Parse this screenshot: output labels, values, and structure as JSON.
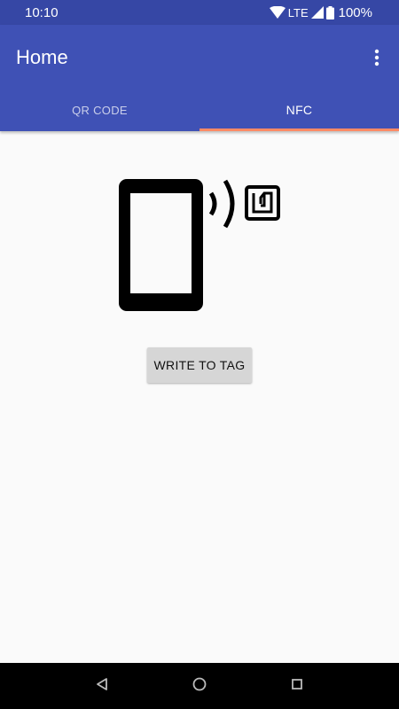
{
  "status_bar": {
    "time": "10:10",
    "network": "LTE",
    "battery": "100%"
  },
  "app_bar": {
    "title": "Home",
    "overflow_icon": "more-vert-icon"
  },
  "tabs": [
    {
      "label": "QR CODE",
      "selected": false
    },
    {
      "label": "NFC",
      "selected": true
    }
  ],
  "content": {
    "illustration_icons": [
      "phone-icon",
      "nfc-signal-icon",
      "nfc-tag-icon"
    ],
    "write_button_label": "WRITE TO TAG"
  },
  "nav_bar": {
    "icons": [
      "back-icon",
      "home-icon",
      "recents-icon"
    ]
  },
  "colors": {
    "primary": "#3f51b5",
    "primary_dark": "#3647a5",
    "accent": "#ff8a65",
    "background": "#fafafa",
    "button": "#d6d6d6"
  }
}
